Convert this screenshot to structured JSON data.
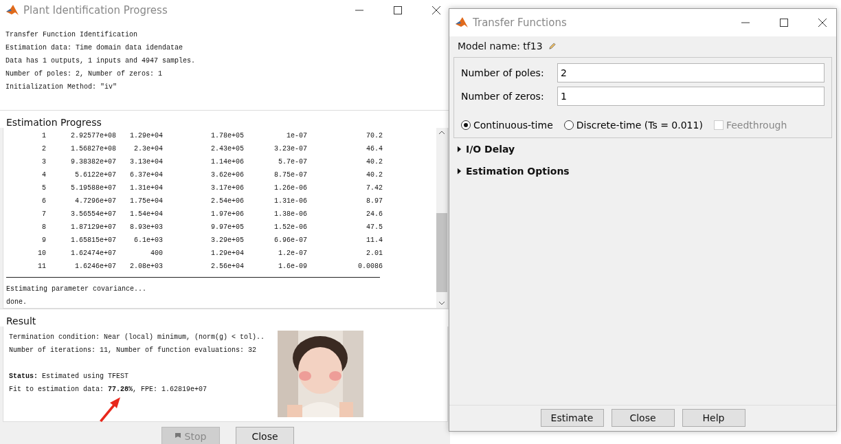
{
  "progress_window": {
    "title": "Plant Identification Progress",
    "header_lines": [
      "Transfer Function Identification",
      "Estimation data: Time domain data idendatae",
      "Data has 1 outputs, 1 inputs and 4947 samples.",
      "Number of poles: 2, Number of zeros: 1",
      "Initialization Method: \"iv\""
    ],
    "estimation_progress": {
      "title": "Estimation Progress",
      "rows": [
        [
          "1",
          "2.92577e+08",
          "1.29e+04",
          "1.78e+05",
          "1e-07",
          "70.2"
        ],
        [
          "2",
          "1.56827e+08",
          "2.3e+04",
          "2.43e+05",
          "3.23e-07",
          "46.4"
        ],
        [
          "3",
          "9.38382e+07",
          "3.13e+04",
          "1.14e+06",
          "5.7e-07",
          "40.2"
        ],
        [
          "4",
          "5.6122e+07",
          "6.37e+04",
          "3.62e+06",
          "8.75e-07",
          "40.2"
        ],
        [
          "5",
          "5.19588e+07",
          "1.31e+04",
          "3.17e+06",
          "1.26e-06",
          "7.42"
        ],
        [
          "6",
          "4.7296e+07",
          "1.75e+04",
          "2.54e+06",
          "1.31e-06",
          "8.97"
        ],
        [
          "7",
          "3.56554e+07",
          "1.54e+04",
          "1.97e+06",
          "1.38e-06",
          "24.6"
        ],
        [
          "8",
          "1.87129e+07",
          "8.93e+03",
          "9.97e+05",
          "1.52e-06",
          "47.5"
        ],
        [
          "9",
          "1.65815e+07",
          "6.1e+03",
          "3.29e+05",
          "6.96e-07",
          "11.4"
        ],
        [
          "10",
          "1.62474e+07",
          "400",
          "1.29e+04",
          "1.2e-07",
          "2.01"
        ],
        [
          "11",
          "1.6246e+07",
          "2.08e+03",
          "2.56e+04",
          "1.6e-09",
          "0.0086"
        ]
      ],
      "footer_lines": [
        "Estimating parameter covariance...",
        "done."
      ]
    },
    "result": {
      "title": "Result",
      "paragraphs": [
        [
          "Termination condition: Near (local) minimum, (norm(g) < tol)..",
          "Number of iterations: 11, Number of function evaluations: 32"
        ],
        [
          "**Status:** Estimated using TFEST",
          "Fit to estimation data: **77.28%**, FPE: 1.62819e+07"
        ]
      ],
      "picture": {
        "kind": "picture"
      }
    },
    "buttons": [
      {
        "label": "Stop",
        "disabled": true
      },
      {
        "label": "Close",
        "disabled": false
      }
    ]
  },
  "tf_window": {
    "title": "Transfer Functions",
    "model_name": "Model name: tf13",
    "fields": [
      {
        "label": "Number of poles:",
        "value": "2"
      },
      {
        "label": "Number of zeros:",
        "value": "1"
      }
    ],
    "options": [
      {
        "kind": "radio",
        "label": "Continuous-time",
        "selected": true
      },
      {
        "kind": "radio",
        "label": "Discrete-time (Ts = 0.011)",
        "selected": false
      },
      {
        "kind": "checkbox",
        "label": "Feedthrough",
        "checked": false,
        "disabled": true
      }
    ],
    "sections": [
      {
        "label": "I/O Delay",
        "expanded": false
      },
      {
        "label": "Estimation Options",
        "expanded": false
      }
    ],
    "buttons": [
      "Estimate",
      "Close",
      "Help"
    ]
  }
}
